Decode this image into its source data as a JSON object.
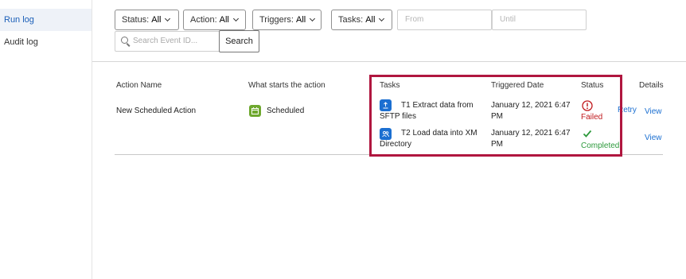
{
  "sidebar": {
    "items": [
      {
        "label": "Run log",
        "active": true
      },
      {
        "label": "Audit log",
        "active": false
      }
    ]
  },
  "filters": {
    "status": {
      "label": "Status:",
      "value": "All"
    },
    "action": {
      "label": "Action:",
      "value": "All"
    },
    "triggers": {
      "label": "Triggers:",
      "value": "All"
    },
    "tasks": {
      "label": "Tasks:",
      "value": "All"
    },
    "from_placeholder": "From",
    "until_placeholder": "Until",
    "search_placeholder": "Search Event ID...",
    "search_button": "Search"
  },
  "table": {
    "headers": {
      "action_name": "Action Name",
      "starts": "What starts the action",
      "tasks": "Tasks",
      "triggered_date": "Triggered Date",
      "status": "Status",
      "details": "Details"
    },
    "rows": [
      {
        "action_name": "New Scheduled Action",
        "trigger": "Scheduled",
        "tasks": [
          {
            "title_line1": "T1 Extract data from",
            "title_line2": "SFTP files",
            "date_line1": "January 12, 2021 6:47",
            "date_line2": "PM",
            "status": "Failed",
            "retry": "Retry",
            "view": "View"
          },
          {
            "title_line1": "T2 Load data into XM",
            "title_line2": "Directory",
            "date_line1": "January 12, 2021 6:47",
            "date_line2": "PM",
            "status": "Completed",
            "view": "View"
          }
        ]
      }
    ]
  },
  "colors": {
    "accent": "#1b6fd1",
    "failed": "#c0191d",
    "completed": "#2e9a3d",
    "highlight": "#b0163f",
    "scheduled_badge": "#6fa82f"
  },
  "icons": {
    "scheduled": "calendar-icon",
    "task1": "upload-icon",
    "task2": "users-icon",
    "failed": "alert-circle-icon",
    "completed": "checkmark-icon",
    "search": "search-icon"
  }
}
